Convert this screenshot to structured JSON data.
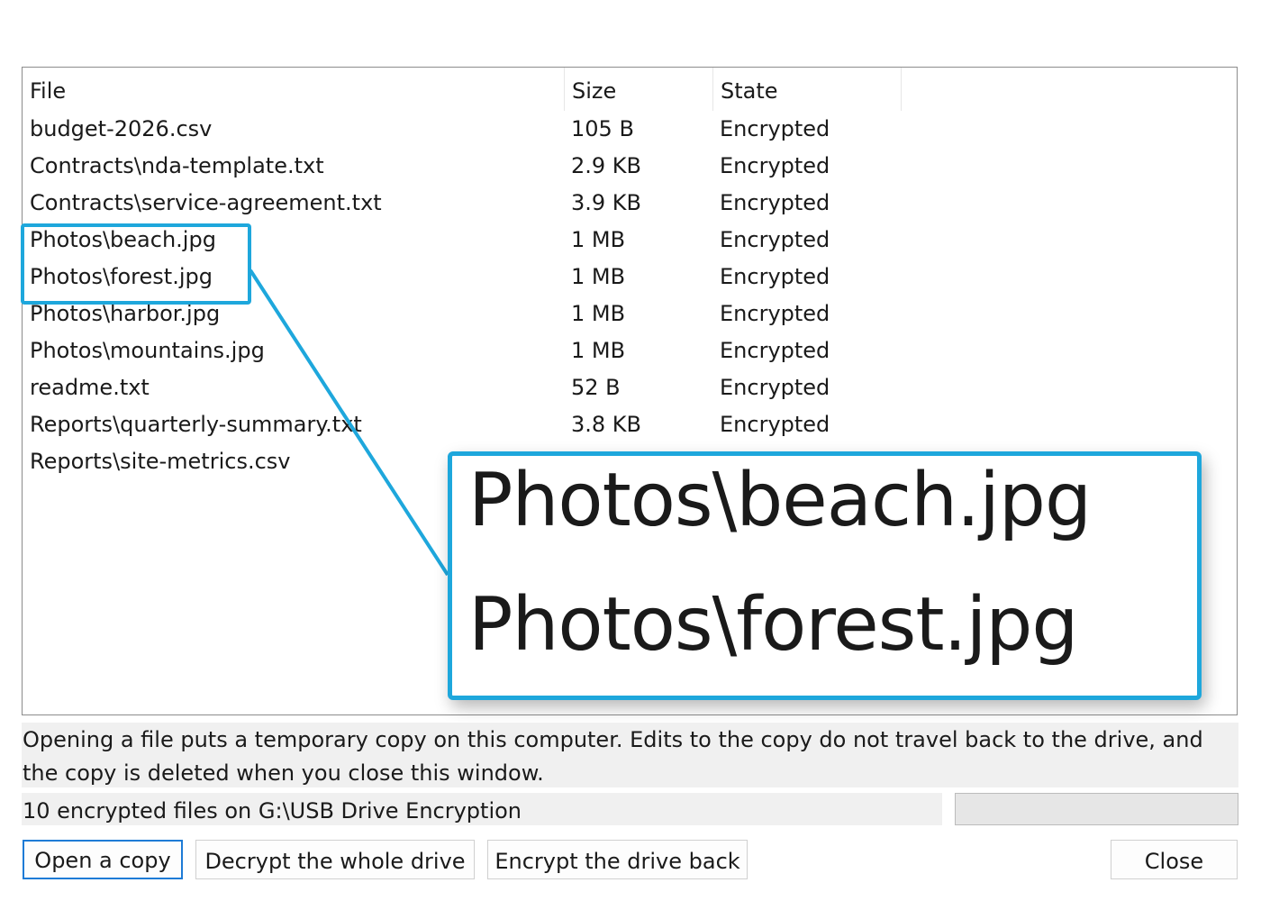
{
  "file_list": {
    "columns": {
      "file": "File",
      "size": "Size",
      "state": "State"
    },
    "rows": [
      {
        "file": "budget-2026.csv",
        "size": "105 B",
        "state": "Encrypted"
      },
      {
        "file": "Contracts\\nda-template.txt",
        "size": "2.9 KB",
        "state": "Encrypted"
      },
      {
        "file": "Contracts\\service-agreement.txt",
        "size": "3.9 KB",
        "state": "Encrypted"
      },
      {
        "file": "Photos\\beach.jpg",
        "size": "1 MB",
        "state": "Encrypted"
      },
      {
        "file": "Photos\\forest.jpg",
        "size": "1 MB",
        "state": "Encrypted"
      },
      {
        "file": "Photos\\harbor.jpg",
        "size": "1 MB",
        "state": "Encrypted"
      },
      {
        "file": "Photos\\mountains.jpg",
        "size": "1 MB",
        "state": "Encrypted"
      },
      {
        "file": "readme.txt",
        "size": "52 B",
        "state": "Encrypted"
      },
      {
        "file": "Reports\\quarterly-summary.txt",
        "size": "3.8 KB",
        "state": "Encrypted"
      },
      {
        "file": "Reports\\site-metrics.csv",
        "size": "",
        "state": ""
      }
    ]
  },
  "zoom_callout": {
    "lines": [
      "Photos\\beach.jpg",
      "Photos\\forest.jpg"
    ],
    "accent_color": "#1ea7dc"
  },
  "notice": "Opening a file puts a temporary copy on this computer. Edits to the copy do not travel back to the drive, and the copy is deleted when you close this window.",
  "status": {
    "text": "10 encrypted files on G:\\USB Drive Encryption",
    "progress": 0
  },
  "buttons": {
    "open_copy": "Open a copy",
    "decrypt_drive": "Decrypt the whole drive",
    "encrypt_back": "Encrypt the drive back",
    "close": "Close"
  }
}
